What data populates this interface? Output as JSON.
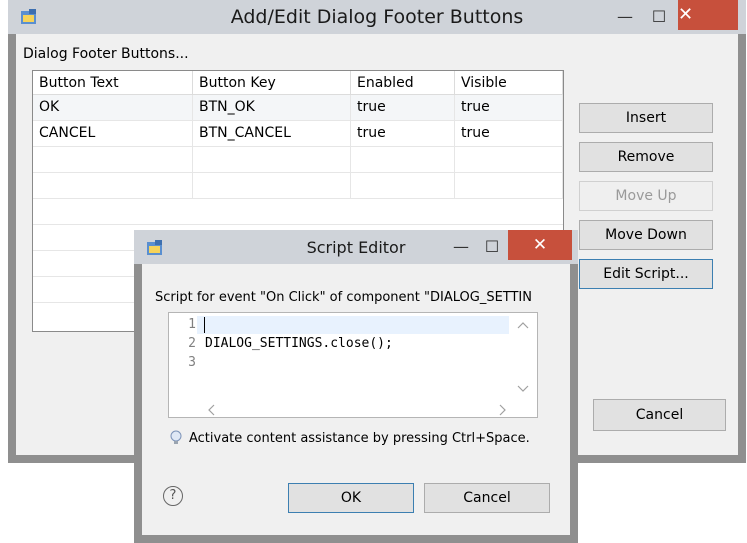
{
  "main_dialog": {
    "title": "Add/Edit Dialog Footer Buttons",
    "caption": "Dialog Footer Buttons...",
    "columns": [
      "Button Text",
      "Button Key",
      "Enabled",
      "Visible"
    ],
    "rows": [
      [
        "OK",
        "BTN_OK",
        "true",
        "true"
      ],
      [
        "CANCEL",
        "BTN_CANCEL",
        "true",
        "true"
      ]
    ],
    "buttons": {
      "insert": "Insert",
      "remove": "Remove",
      "move_up": "Move Up",
      "move_down": "Move Down",
      "edit_script": "Edit Script...",
      "cancel": "Cancel"
    },
    "window_controls": {
      "minimize": "—",
      "maximize": "☐",
      "close": "✕"
    }
  },
  "script_editor": {
    "title": "Script Editor",
    "caption": "Script for event \"On Click\" of component \"DIALOG_SETTIN",
    "line_numbers": [
      "1",
      "2",
      "3"
    ],
    "code_lines": [
      "",
      "DIALOG_SETTINGS.close();",
      ""
    ],
    "hint": "Activate content assistance by pressing Ctrl+Space.",
    "ok_label": "OK",
    "cancel_label": "Cancel",
    "help_glyph": "?",
    "window_controls": {
      "minimize": "—",
      "maximize": "☐",
      "close": "✕"
    }
  },
  "icons": [
    "app-icon",
    "lightbulb-icon",
    "help-icon",
    "minimize-icon",
    "maximize-icon",
    "close-icon"
  ],
  "colors": {
    "close_button": "#c7503c",
    "titlebar": "#cfd3d9",
    "frame": "#8f8f8f",
    "focus_border": "#3c7fb1"
  }
}
